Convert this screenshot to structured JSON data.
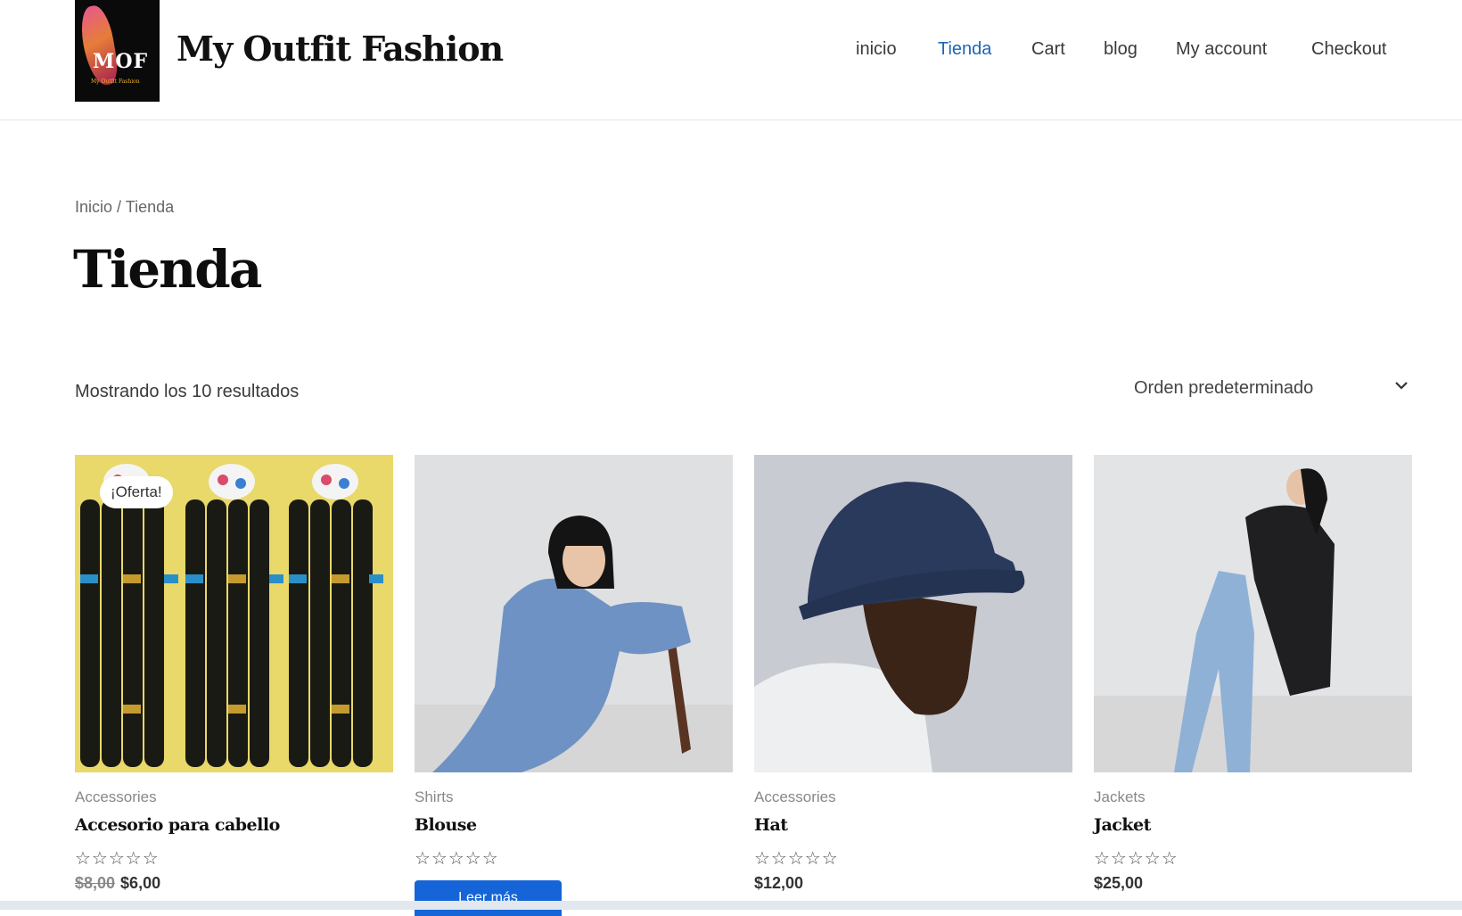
{
  "header": {
    "logo_text": "MOF",
    "logo_subtext": "My Outfit Fashion",
    "site_title": "My Outfit Fashion",
    "nav": [
      {
        "label": "inicio"
      },
      {
        "label": "Tienda"
      },
      {
        "label": "Cart"
      },
      {
        "label": "blog"
      },
      {
        "label": "My account"
      },
      {
        "label": "Checkout"
      }
    ]
  },
  "breadcrumb": {
    "home": "Inicio",
    "sep": "/",
    "current": "Tienda"
  },
  "page_title": "Tienda",
  "result_count": "Mostrando los 10 resultados",
  "orderby": {
    "selected": "Orden predeterminado"
  },
  "products": [
    {
      "category": "Accessories",
      "name": "Accesorio para cabello",
      "old_price": "$8,00",
      "price": "$6,00",
      "badge": "¡Oferta!",
      "rating": 0
    },
    {
      "category": "Shirts",
      "name": "Blouse",
      "button": "Leer más",
      "rating": 0
    },
    {
      "category": "Accessories",
      "name": "Hat",
      "price": "$12,00",
      "rating": 0
    },
    {
      "category": "Jackets",
      "name": "Jacket",
      "price": "$25,00",
      "rating": 0
    }
  ],
  "stars_glyph": "☆☆☆☆☆",
  "colors": {
    "accent": "#1e65b8",
    "button": "#1565d8"
  }
}
